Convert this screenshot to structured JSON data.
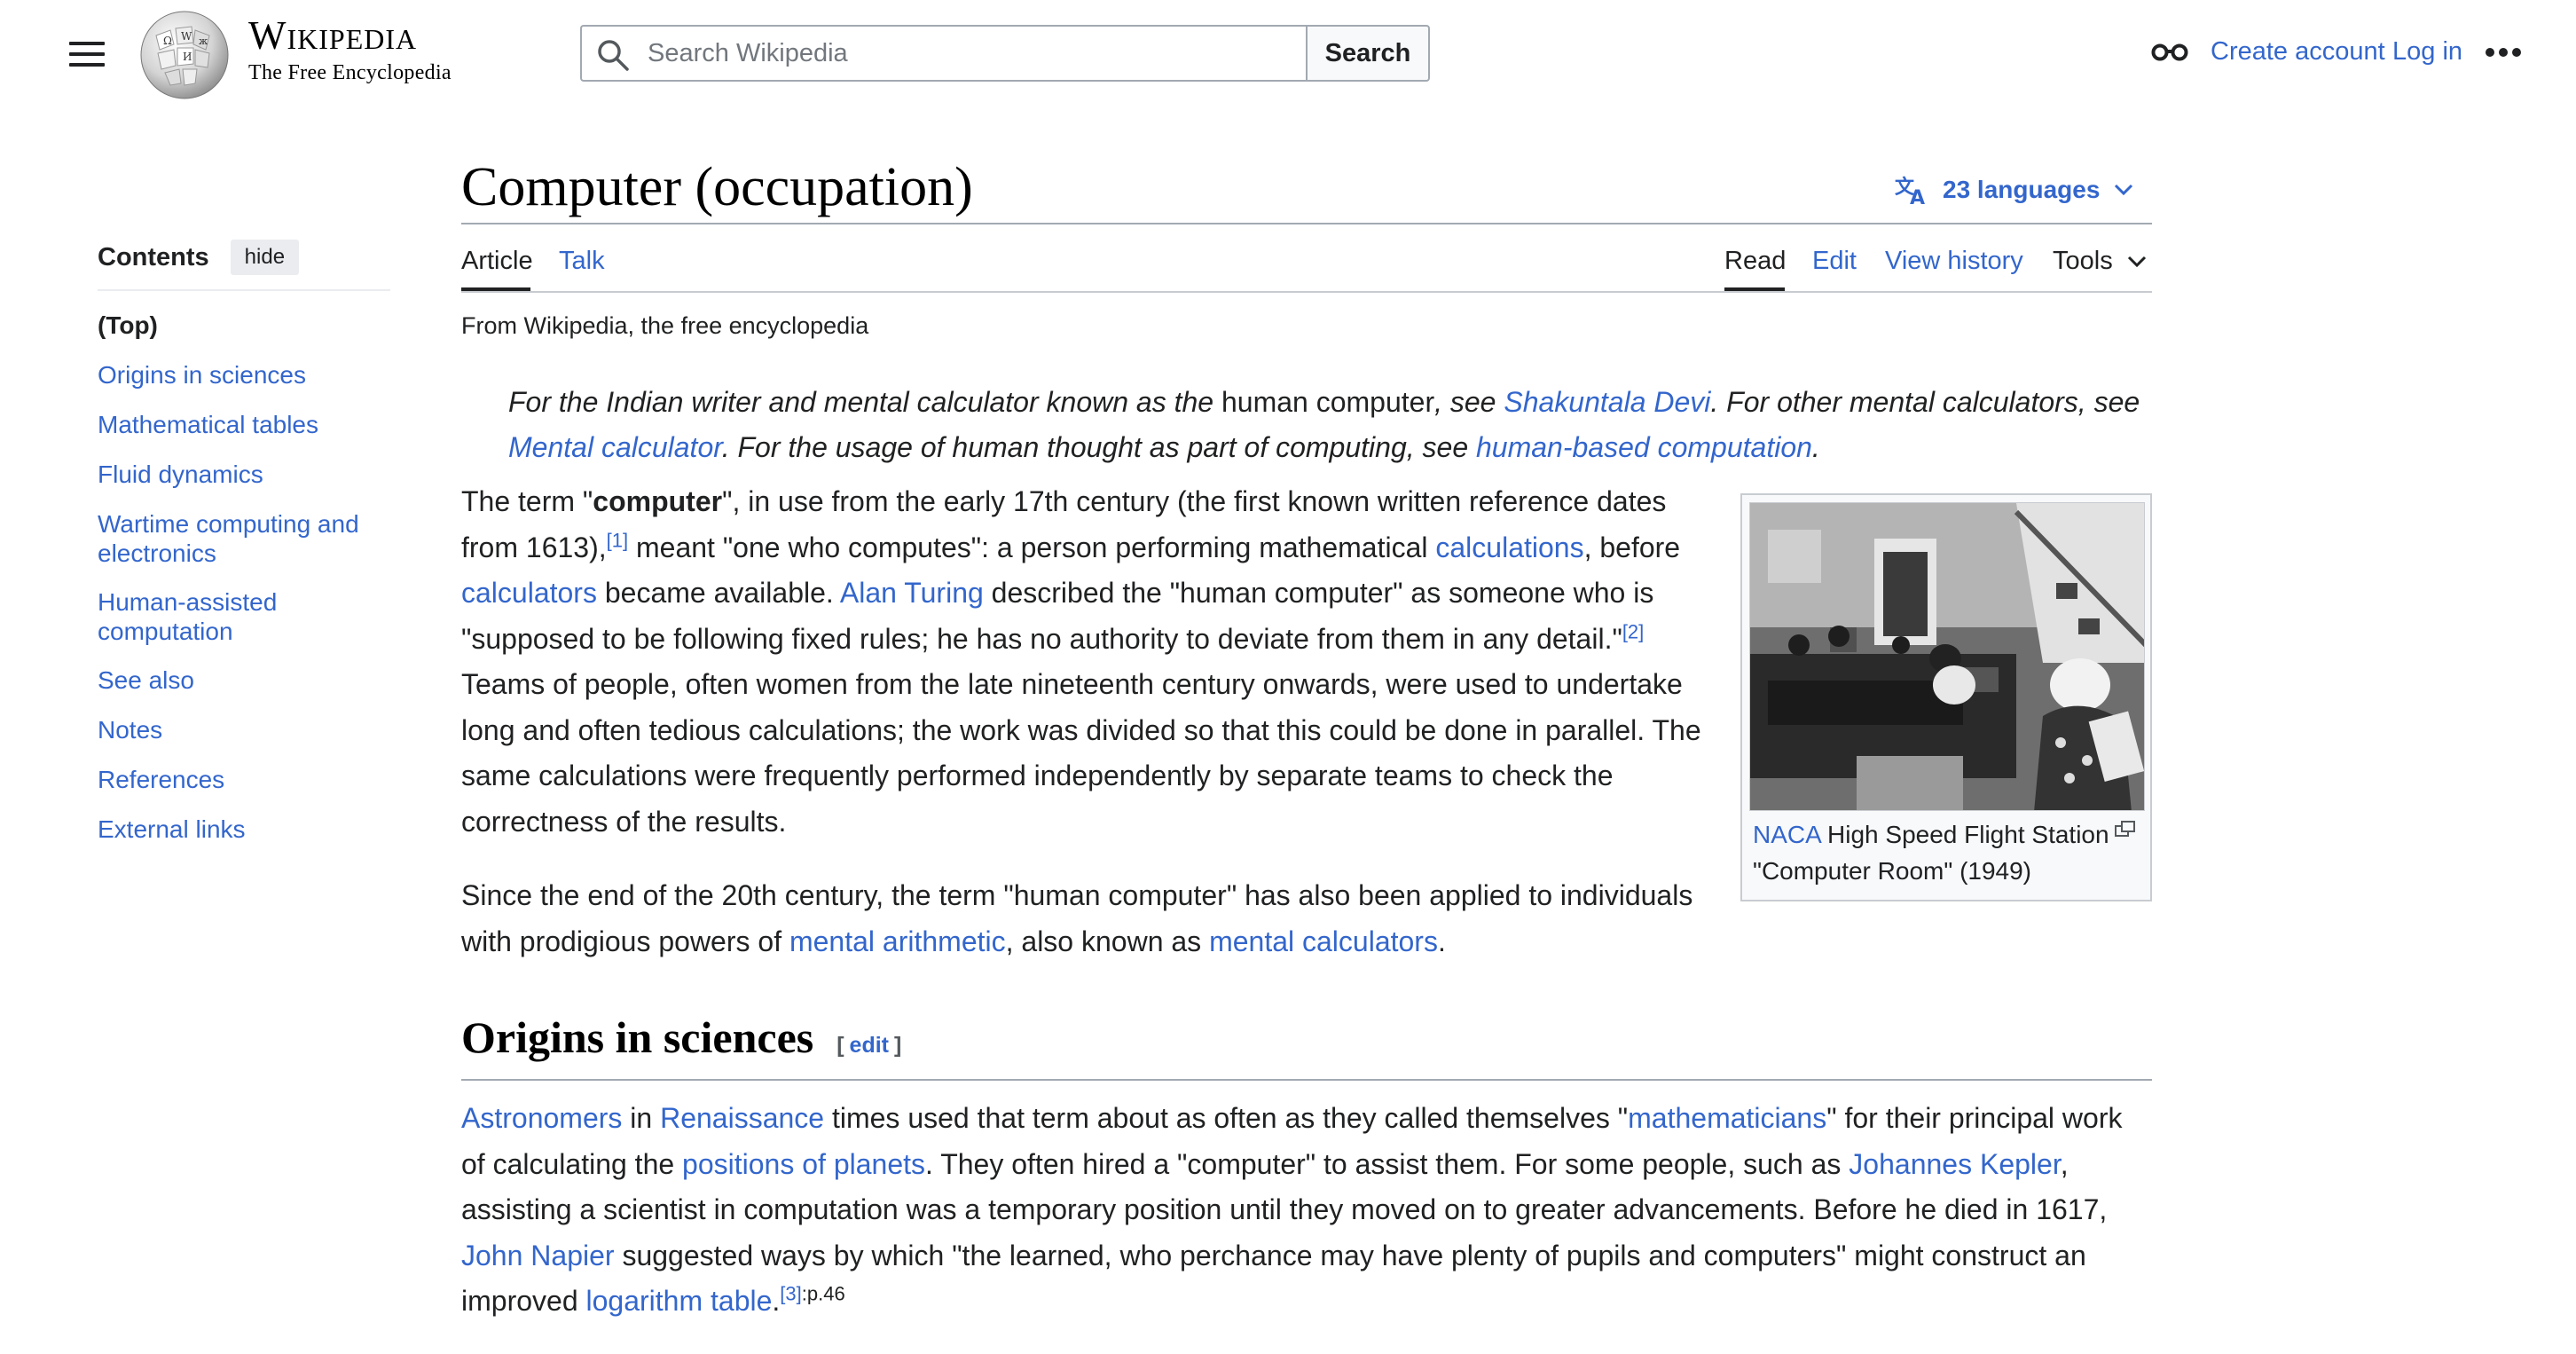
{
  "header": {
    "menu_icon": "hamburger-menu-icon",
    "logo": {
      "wordmark": "Wikipedia",
      "tagline": "The Free Encyclopedia",
      "icon": "wikipedia-globe-icon"
    },
    "search": {
      "placeholder": "Search Wikipedia",
      "value": "",
      "button_label": "Search",
      "icon": "search-icon"
    },
    "user": {
      "icon": "glasses-icon",
      "create_account": "Create account",
      "login": "Log in",
      "more_icon": "ellipsis-icon"
    }
  },
  "toc": {
    "title": "Contents",
    "hide_label": "hide",
    "items": [
      "(Top)",
      "Origins in sciences",
      "Mathematical tables",
      "Fluid dynamics",
      "Wartime computing and electronics",
      "Human-assisted computation",
      "See also",
      "Notes",
      "References",
      "External links"
    ]
  },
  "article": {
    "title": "Computer (occupation)",
    "languages_label": "23 languages",
    "tabs": {
      "article": "Article",
      "talk": "Talk",
      "read": "Read",
      "edit": "Edit",
      "view_history": "View history",
      "tools": "Tools"
    },
    "tagline": "From Wikipedia, the free encyclopedia",
    "hatnote": {
      "t1": "For the Indian writer and mental calculator known as the ",
      "t2": "human computer",
      "t3": ", see ",
      "l1": "Shakuntala Devi",
      "t4": ". For other mental calculators, see ",
      "l2": "Mental calculator",
      "t5": ". For the usage of human thought as part of computing, see ",
      "l3": "human-based computation",
      "t6": "."
    },
    "p1": {
      "t1": "The term \"",
      "b1": "computer",
      "t2": "\", in use from the early 17th century (the first known written reference dates from 1613),",
      "ref1": "[1]",
      "t3": " meant \"one who computes\": a person performing mathematical ",
      "l1": "calculations",
      "t4": ", before ",
      "l2": "calculators",
      "t5": " became available. ",
      "l3": "Alan Turing",
      "t6": " described the \"human computer\" as someone who is \"supposed to be following fixed rules; he has no authority to deviate from them in any detail.\"",
      "ref2": "[2]",
      "t7": " Teams of people, often women from the late nineteenth century onwards, were used to undertake long and often tedious calculations; the work was divided so that this could be done in parallel. The same calculations were frequently performed independently by separate teams to check the correctness of the results."
    },
    "p2": {
      "t1": "Since the end of the 20th century, the term \"human computer\" has also been applied to individuals with prodigious powers of ",
      "l1": "mental arithmetic",
      "t2": ", also known as ",
      "l2": "mental calculators",
      "t3": "."
    },
    "figure": {
      "caption_link": "NACA",
      "caption_text": " High Speed Flight Station \"Computer Room\" (1949)",
      "enlarge_icon": "enlarge-icon"
    },
    "section1": {
      "heading": "Origins in sciences",
      "edit_open": "[",
      "edit_label": "edit",
      "edit_close": "]",
      "p": {
        "l1": "Astronomers",
        "t1": " in ",
        "l2": "Renaissance",
        "t2": " times used that term about as often as they called themselves \"",
        "l3": "mathematicians",
        "t3": "\" for their principal work of calculating the ",
        "l4": "positions of planets",
        "t4": ". They often hired a \"computer\" to assist them. For some people, such as ",
        "l5": "Johannes Kepler",
        "t5": ", assisting a scientist in computation was a temporary position until they moved on to greater advancements. Before he died in 1617, ",
        "l6": "John Napier",
        "t6": " suggested ways by which \"the learned, who perchance may have plenty of pupils and computers\" might construct an improved ",
        "l7": "logarithm table",
        "t7": ".",
        "ref3": "[3]",
        "ref3_page": ":p.46"
      }
    }
  },
  "colors": {
    "link": "#3366cc",
    "text": "#202122",
    "rule": "#a2a9b1",
    "chip_bg": "#eaecf0"
  }
}
